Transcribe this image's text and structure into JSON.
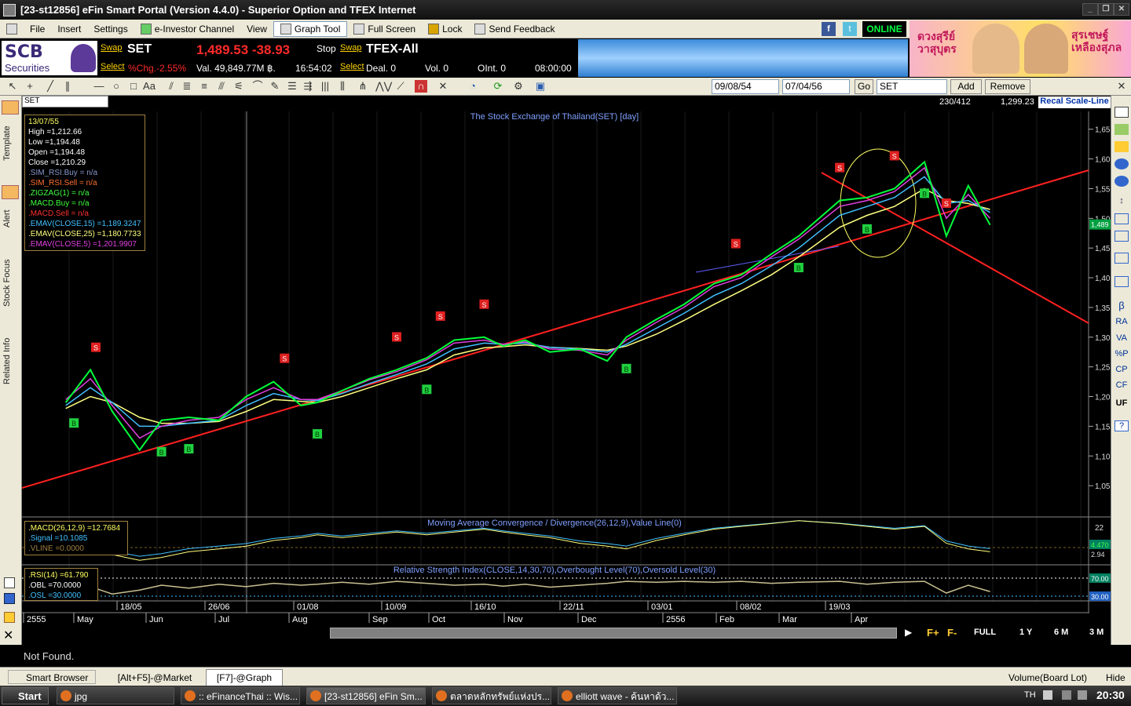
{
  "window": {
    "title": "[23-st12856] eFin Smart Portal (Version 4.4.0) - Superior Option and TFEX Internet",
    "controls": [
      "_",
      "❐",
      "✕"
    ]
  },
  "menu": {
    "items": [
      "File",
      "Insert",
      "Settings",
      "e-Investor Channel",
      "View",
      "Graph Tool",
      "Full Screen",
      "Lock",
      "Send Feedback"
    ],
    "online": "ONLINE"
  },
  "quote": {
    "broker_name": "SCB",
    "broker_sub": "Securities",
    "swap": "Swap",
    "select": "Select",
    "symbol": "SET",
    "price": "1,489.53 -38.93",
    "pct_chg": "%Chg.-2.55%",
    "value": "Val. 49,849.77M ฿.",
    "time": "16:54:02",
    "stop": "Stop",
    "tfex_symbol": "TFEX-All",
    "deal": "Deal. 0",
    "vol": "Vol. 0",
    "oint": "OInt. 0",
    "tfex_time": "08:00:00"
  },
  "banner": {
    "left_text": "ดวงสุรีย์\nวาสุบุตร",
    "right_text": "สุรเชษฐ์\nเหลืองสุภล"
  },
  "toolbar": {
    "date_from": "09/08/54",
    "date_to": "07/04/56",
    "go": "Go",
    "symbol": "SET",
    "add": "Add",
    "remove": "Remove"
  },
  "chart_header": {
    "symbol_box": "SET",
    "counter": "230/412",
    "cursor_value": "1,299.23",
    "recal": "Recal Scale-Line"
  },
  "side_tabs": [
    "Template",
    "Alert",
    "Stock Focus",
    "Related Info"
  ],
  "right_tools": [
    "β",
    "RA",
    "VA",
    "%P",
    "CP",
    "CF",
    "UF",
    "?"
  ],
  "legend_main": {
    "date": "13/07/55",
    "high": "High  =1,212.66",
    "low": "Low  =1,194.48",
    "open": "Open  =1,194.48",
    "close": "Close  =1,210.29",
    "sim_rsi_buy": ".SIM_RSI.Buy   = n/a",
    "sim_rsi_sell": ".SIM_RSI.Sell   = n/a",
    "zigzag": ".ZIGZAG(1)   = n/a",
    "macd_buy": ".MACD.Buy   = n/a",
    "macd_sell": ".MACD.Sell   = n/a",
    "emav15": ".EMAV(CLOSE,15)   =1,189.3247",
    "emav25": ".EMAV(CLOSE,25)   =1,180.7733",
    "emav5": ".EMAV(CLOSE,5)   =1,201.9907"
  },
  "legend_macd": {
    "macd": ".MACD(26,12,9)   =12.7684",
    "signal": ".Signal   =10.1085",
    "vline": ".VLINE   =0.0000"
  },
  "legend_rsi": {
    "rsi": ".RSI(14)   =61.790",
    "obl": ".OBL   =70.0000",
    "osl": ".OSL   =30.0000"
  },
  "chart_data": [
    {
      "type": "line",
      "title": "The Stock Exchange of Thailand(SET) [day]",
      "y_ticks": [
        "1,65",
        "1,60",
        "1,55",
        "1,50",
        "1,45",
        "1,40",
        "1,35",
        "1,30",
        "1,25",
        "1,20",
        "1,15",
        "1,10",
        "1,05"
      ],
      "ylim": [
        1000,
        1680
      ],
      "last_price_label": "1,489",
      "x_ticks_top": [
        "18/05",
        "26/06",
        "01/08",
        "10/09",
        "16/10",
        "22/11",
        "03/01",
        "08/02",
        "19/03"
      ],
      "x_ticks_bottom": [
        "2555",
        "May",
        "Jun",
        "Jul",
        "Aug",
        "Sep",
        "Oct",
        "Nov",
        "Dec",
        "2556",
        "Feb",
        "Mar",
        "Apr"
      ],
      "x": [
        "2012-05-01",
        "2012-05-10",
        "2012-05-18",
        "2012-05-28",
        "2012-06-05",
        "2012-06-15",
        "2012-06-26",
        "2012-07-06",
        "2012-07-16",
        "2012-07-26",
        "2012-08-01",
        "2012-08-10",
        "2012-08-20",
        "2012-08-30",
        "2012-09-10",
        "2012-09-20",
        "2012-10-01",
        "2012-10-08",
        "2012-10-16",
        "2012-10-25",
        "2012-11-05",
        "2012-11-15",
        "2012-11-22",
        "2012-12-03",
        "2012-12-13",
        "2012-12-24",
        "2013-01-03",
        "2013-01-14",
        "2013-01-24",
        "2013-02-08",
        "2013-02-18",
        "2013-02-28",
        "2013-03-11",
        "2013-03-19",
        "2013-03-27",
        "2013-04-04"
      ],
      "series": [
        {
          "name": "SET",
          "color": "#00ff3a",
          "values": [
            1190,
            1245,
            1175,
            1110,
            1160,
            1165,
            1160,
            1200,
            1225,
            1185,
            1190,
            1210,
            1230,
            1245,
            1265,
            1295,
            1300,
            1285,
            1295,
            1275,
            1280,
            1260,
            1300,
            1330,
            1355,
            1390,
            1405,
            1440,
            1470,
            1530,
            1535,
            1550,
            1595,
            1470,
            1555,
            1489
          ]
        },
        {
          "name": "EMAV(CLOSE,5)",
          "color": "#e040e0",
          "values": [
            1195,
            1230,
            1185,
            1130,
            1150,
            1160,
            1165,
            1195,
            1215,
            1195,
            1195,
            1210,
            1228,
            1242,
            1262,
            1290,
            1295,
            1288,
            1292,
            1280,
            1278,
            1270,
            1295,
            1325,
            1350,
            1385,
            1400,
            1435,
            1465,
            1520,
            1530,
            1545,
            1585,
            1500,
            1540,
            1500
          ]
        },
        {
          "name": "EMAV(CLOSE,15)",
          "color": "#40c0ff",
          "values": [
            1185,
            1215,
            1190,
            1150,
            1150,
            1155,
            1160,
            1185,
            1205,
            1195,
            1193,
            1205,
            1222,
            1237,
            1255,
            1280,
            1290,
            1288,
            1290,
            1283,
            1280,
            1275,
            1288,
            1315,
            1340,
            1370,
            1390,
            1420,
            1450,
            1505,
            1520,
            1535,
            1570,
            1525,
            1530,
            1510
          ]
        },
        {
          "name": "EMAV(CLOSE,25)",
          "color": "#ffff80",
          "values": [
            1180,
            1200,
            1190,
            1165,
            1155,
            1155,
            1158,
            1175,
            1195,
            1192,
            1190,
            1200,
            1215,
            1230,
            1245,
            1270,
            1282,
            1284,
            1287,
            1283,
            1281,
            1278,
            1285,
            1305,
            1328,
            1355,
            1378,
            1405,
            1435,
            1485,
            1505,
            1520,
            1550,
            1530,
            1525,
            1515
          ]
        }
      ],
      "buy_signals": [
        {
          "x": "2012-05-04",
          "label": "B"
        },
        {
          "x": "2012-06-05",
          "label": "B"
        },
        {
          "x": "2012-06-15",
          "label": "B"
        },
        {
          "x": "2012-08-01",
          "label": "B"
        },
        {
          "x": "2012-09-10",
          "label": "B"
        },
        {
          "x": "2012-11-22",
          "label": "B"
        },
        {
          "x": "2013-01-24",
          "label": "B"
        },
        {
          "x": "2013-02-18",
          "label": "B"
        },
        {
          "x": "2013-03-11",
          "label": "B"
        }
      ],
      "sell_signals": [
        {
          "x": "2012-05-12",
          "label": "S"
        },
        {
          "x": "2012-07-20",
          "label": "S"
        },
        {
          "x": "2012-08-30",
          "label": "S"
        },
        {
          "x": "2012-09-15",
          "label": "S"
        },
        {
          "x": "2012-10-01",
          "label": "S"
        },
        {
          "x": "2013-01-01",
          "label": "S"
        },
        {
          "x": "2013-02-08",
          "label": "S"
        },
        {
          "x": "2013-02-28",
          "label": "S"
        },
        {
          "x": "2013-03-19",
          "label": "S"
        }
      ]
    },
    {
      "type": "line",
      "title": "Moving Average Convergence / Divergence(26,12,9),Value Line(0)",
      "y_ticks": [
        "22"
      ],
      "value_labels": [
        "4.470",
        "2.94"
      ]
    },
    {
      "type": "line",
      "title": "Relative Strength Index(CLOSE,14,30,70),Overbought Level(70),Oversold Level(30)",
      "value_labels": [
        "70.00",
        "30.00"
      ]
    }
  ],
  "nav": {
    "full": "FULL",
    "y1": "1 Y",
    "m6": "6 M",
    "m3": "3 M"
  },
  "status": "Not Found.",
  "bottom_tabs": {
    "smart_browser": "Smart Browser",
    "tab1": "[Alt+F5]-@Market",
    "tab2": "[F7]-@Graph",
    "volume": "Volume(Board Lot)",
    "hide": "Hide"
  },
  "taskbar": {
    "start": "Start",
    "tasks": [
      "jpg",
      ":: eFinanceThai :: Wis...",
      "[23-st12856] eFin Sm...",
      "ตลาดหลักทรัพย์แห่งปร...",
      "elliott wave - ค้นหาด้ว..."
    ],
    "lang": "TH",
    "clock": "20:30"
  }
}
